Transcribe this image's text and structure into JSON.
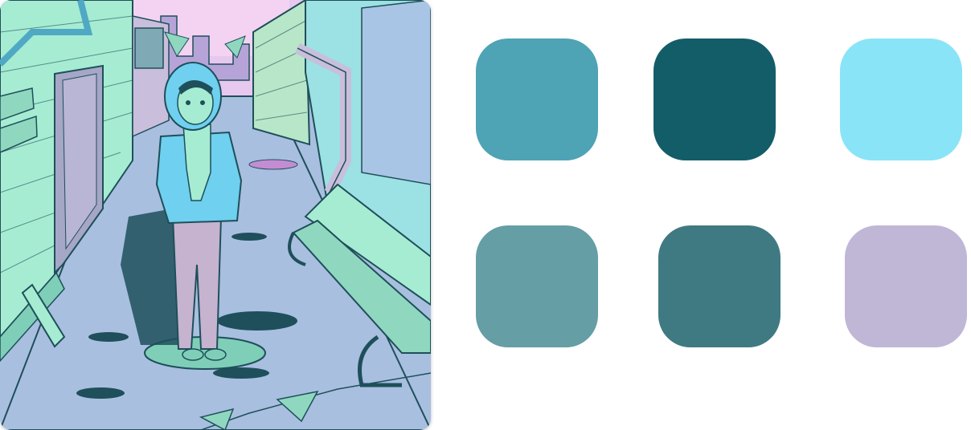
{
  "artwork": {
    "subject": "illustration"
  },
  "palette": {
    "swatches": [
      {
        "color": "#4ea3b5"
      },
      {
        "color": "#135d68"
      },
      {
        "color": "#8ae4f7"
      },
      {
        "color": "#659ea5"
      },
      {
        "color": "#3f7a83"
      },
      {
        "color": "#c0b6d6"
      }
    ]
  }
}
